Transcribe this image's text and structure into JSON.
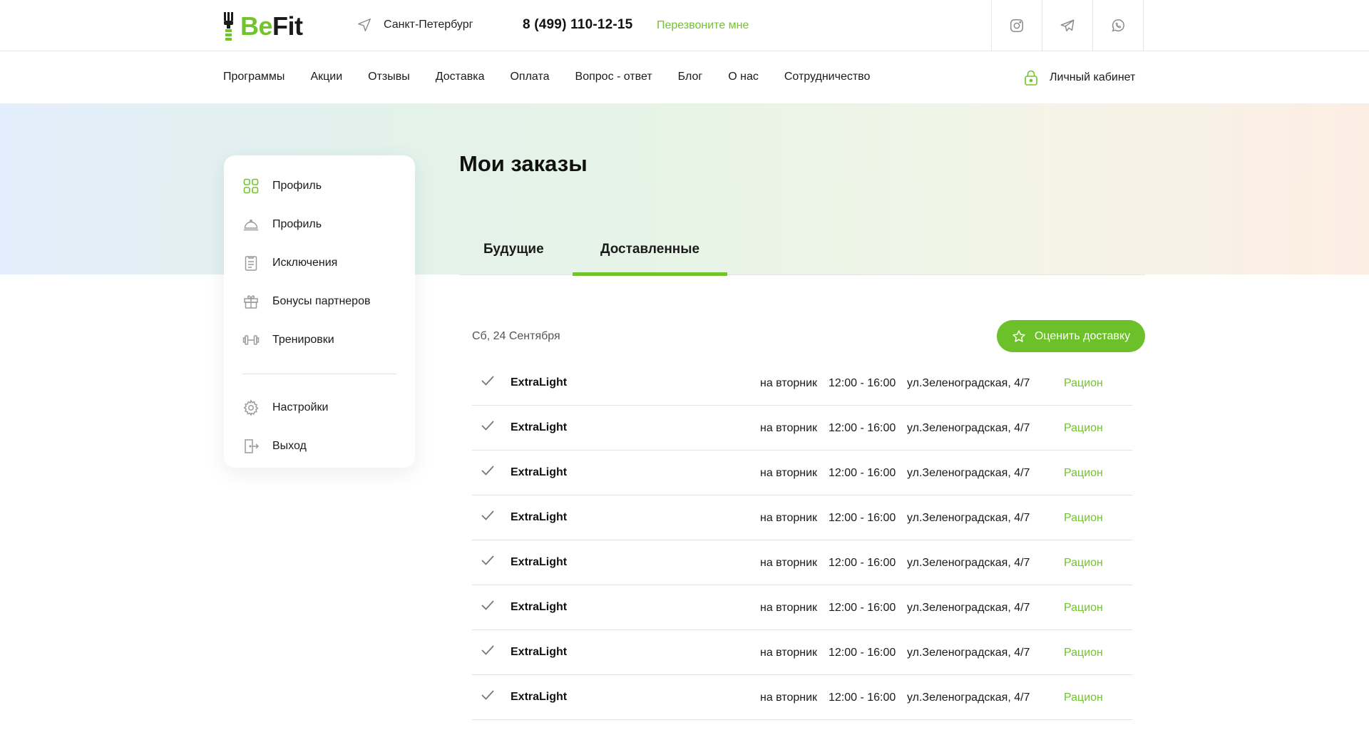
{
  "header": {
    "logo": "BeFit",
    "logo_be": "Be",
    "logo_fit": "Fit",
    "city": "Санкт-Петербург",
    "phone": "8 (499) 110-12-15",
    "callback": "Перезвоните мне",
    "socials": [
      "instagram-icon",
      "telegram-icon",
      "whatsapp-icon"
    ]
  },
  "nav": {
    "items": [
      "Программы",
      "Акции",
      "Отзывы",
      "Доставка",
      "Оплата",
      "Вопрос - ответ",
      "Блог",
      "О нас",
      "Сотрудничество"
    ],
    "cabinet": "Личный кабинет"
  },
  "sidebar": {
    "items": [
      {
        "label": "Профиль",
        "icon": "grid-icon"
      },
      {
        "label": "Профиль",
        "icon": "cloche-icon"
      },
      {
        "label": "Исключения",
        "icon": "clipboard-icon"
      },
      {
        "label": "Бонусы партнеров",
        "icon": "gift-icon"
      },
      {
        "label": "Тренировки",
        "icon": "dumbbell-icon"
      }
    ],
    "bottom_items": [
      {
        "label": "Настройки",
        "icon": "gear-icon"
      },
      {
        "label": "Выход",
        "icon": "exit-icon"
      }
    ]
  },
  "main": {
    "title": "Мои заказы",
    "tabs": [
      {
        "label": "Будущие",
        "active": false
      },
      {
        "label": "Доставленные",
        "active": true
      }
    ],
    "date": "Сб, 24 Сентября",
    "rate_button": "Оценить доставку",
    "orders": [
      {
        "name": "ExtraLight",
        "day": "на вторник",
        "time": "12:00 - 16:00",
        "address": "ул.Зеленоградская, 4/7",
        "link": "Рацион"
      },
      {
        "name": "ExtraLight",
        "day": "на вторник",
        "time": "12:00 - 16:00",
        "address": "ул.Зеленоградская, 4/7",
        "link": "Рацион"
      },
      {
        "name": "ExtraLight",
        "day": "на вторник",
        "time": "12:00 - 16:00",
        "address": "ул.Зеленоградская, 4/7",
        "link": "Рацион"
      },
      {
        "name": "ExtraLight",
        "day": "на вторник",
        "time": "12:00 - 16:00",
        "address": "ул.Зеленоградская, 4/7",
        "link": "Рацион"
      },
      {
        "name": "ExtraLight",
        "day": "на вторник",
        "time": "12:00 - 16:00",
        "address": "ул.Зеленоградская, 4/7",
        "link": "Рацион"
      },
      {
        "name": "ExtraLight",
        "day": "на вторник",
        "time": "12:00 - 16:00",
        "address": "ул.Зеленоградская, 4/7",
        "link": "Рацион"
      },
      {
        "name": "ExtraLight",
        "day": "на вторник",
        "time": "12:00 - 16:00",
        "address": "ул.Зеленоградская, 4/7",
        "link": "Рацион"
      },
      {
        "name": "ExtraLight",
        "day": "на вторник",
        "time": "12:00 - 16:00",
        "address": "ул.Зеленоградская, 4/7",
        "link": "Рацион"
      }
    ]
  },
  "colors": {
    "accent": "#72c42c",
    "button": "#6cc12a",
    "text": "#1b1b1b",
    "border": "#e6e6e6"
  }
}
